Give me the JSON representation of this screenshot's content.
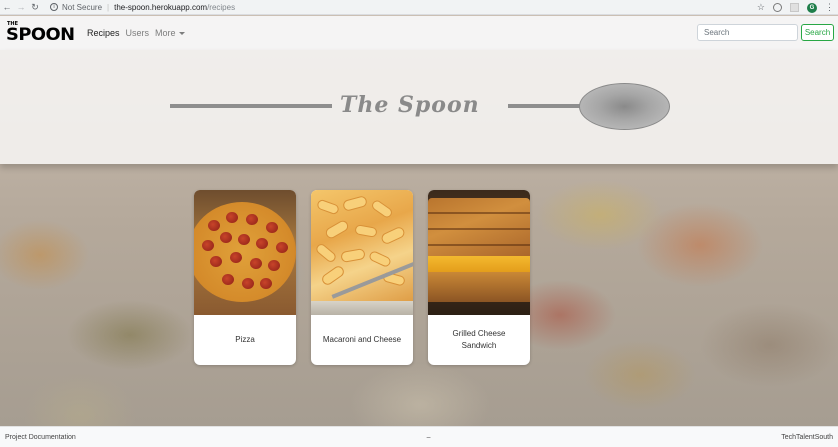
{
  "browser": {
    "security_label": "Not Secure",
    "url_host": "the-spoon.herokuapp.com",
    "url_path": "/recipes",
    "profile_initial": "G",
    "back_icon": "arrow-left-icon",
    "forward_icon": "arrow-right-icon",
    "reload_icon": "reload-icon",
    "bookmark_icon": "star-icon",
    "menu_icon": "kebab-menu-icon"
  },
  "navbar": {
    "logo_small": "THE",
    "logo_main": "SPOON",
    "links": [
      {
        "label": "Recipes",
        "active": true
      },
      {
        "label": "Users",
        "active": false
      },
      {
        "label": "More",
        "active": false
      }
    ],
    "search_placeholder": "Search",
    "search_button": "Search",
    "accent_color": "#28a745"
  },
  "hero": {
    "title": "The Spoon"
  },
  "recipes": [
    {
      "name": "Pizza"
    },
    {
      "name": "Macaroni and Cheese"
    },
    {
      "name": "Grilled Cheese Sandwich"
    }
  ],
  "footer": {
    "left": "Project Documentation",
    "center": "–",
    "right": "TechTalentSouth"
  }
}
